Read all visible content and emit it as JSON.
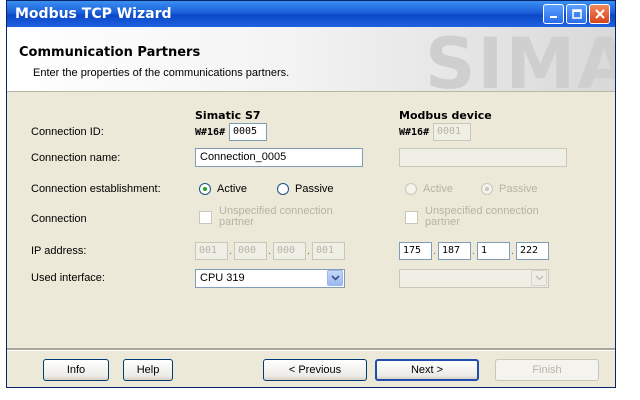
{
  "window": {
    "title": "Modbus TCP Wizard"
  },
  "header": {
    "title": "Communication Partners",
    "subtitle": "Enter the properties of the communications partners.",
    "watermark": "SIMA"
  },
  "columns": {
    "left_title": "Simatic S7",
    "right_title": "Modbus device"
  },
  "labels": {
    "connection_id": "Connection ID:",
    "connection_name": "Connection name:",
    "connection_establishment": "Connection establishment:",
    "connection": "Connection",
    "ip_address": "IP address:",
    "used_interface": "Used interface:"
  },
  "simatic": {
    "id_prefix": "W#16#",
    "id_value": "0005",
    "name_value": "Connection_0005",
    "radio_active": "Active",
    "radio_passive": "Passive",
    "selected": "Active",
    "unspecified_line1": "Unspecified connection",
    "unspecified_line2": "partner",
    "ip": [
      "001",
      "000",
      "000",
      "001"
    ],
    "interface_value": "CPU 319"
  },
  "modbus": {
    "id_prefix": "W#16#",
    "id_value": "0001",
    "name_value": "",
    "radio_active": "Active",
    "radio_passive": "Passive",
    "selected": "Passive",
    "unspecified_line1": "Unspecified connection",
    "unspecified_line2": "partner",
    "ip": [
      "175",
      "187",
      "1",
      "222"
    ],
    "interface_value": ""
  },
  "buttons": {
    "info": "Info",
    "help": "Help",
    "previous": "< Previous",
    "next": "Next >",
    "finish": "Finish"
  },
  "icons": {
    "minimize": "minimize-icon",
    "maximize": "maximize-icon",
    "close": "close-icon",
    "dropdown": "chevron-down-icon"
  },
  "colors": {
    "titlebar": "#1b5fd8",
    "dialog_bg": "#ece9d8",
    "radio_selected": "#21a121",
    "close_button": "#d6431c"
  }
}
